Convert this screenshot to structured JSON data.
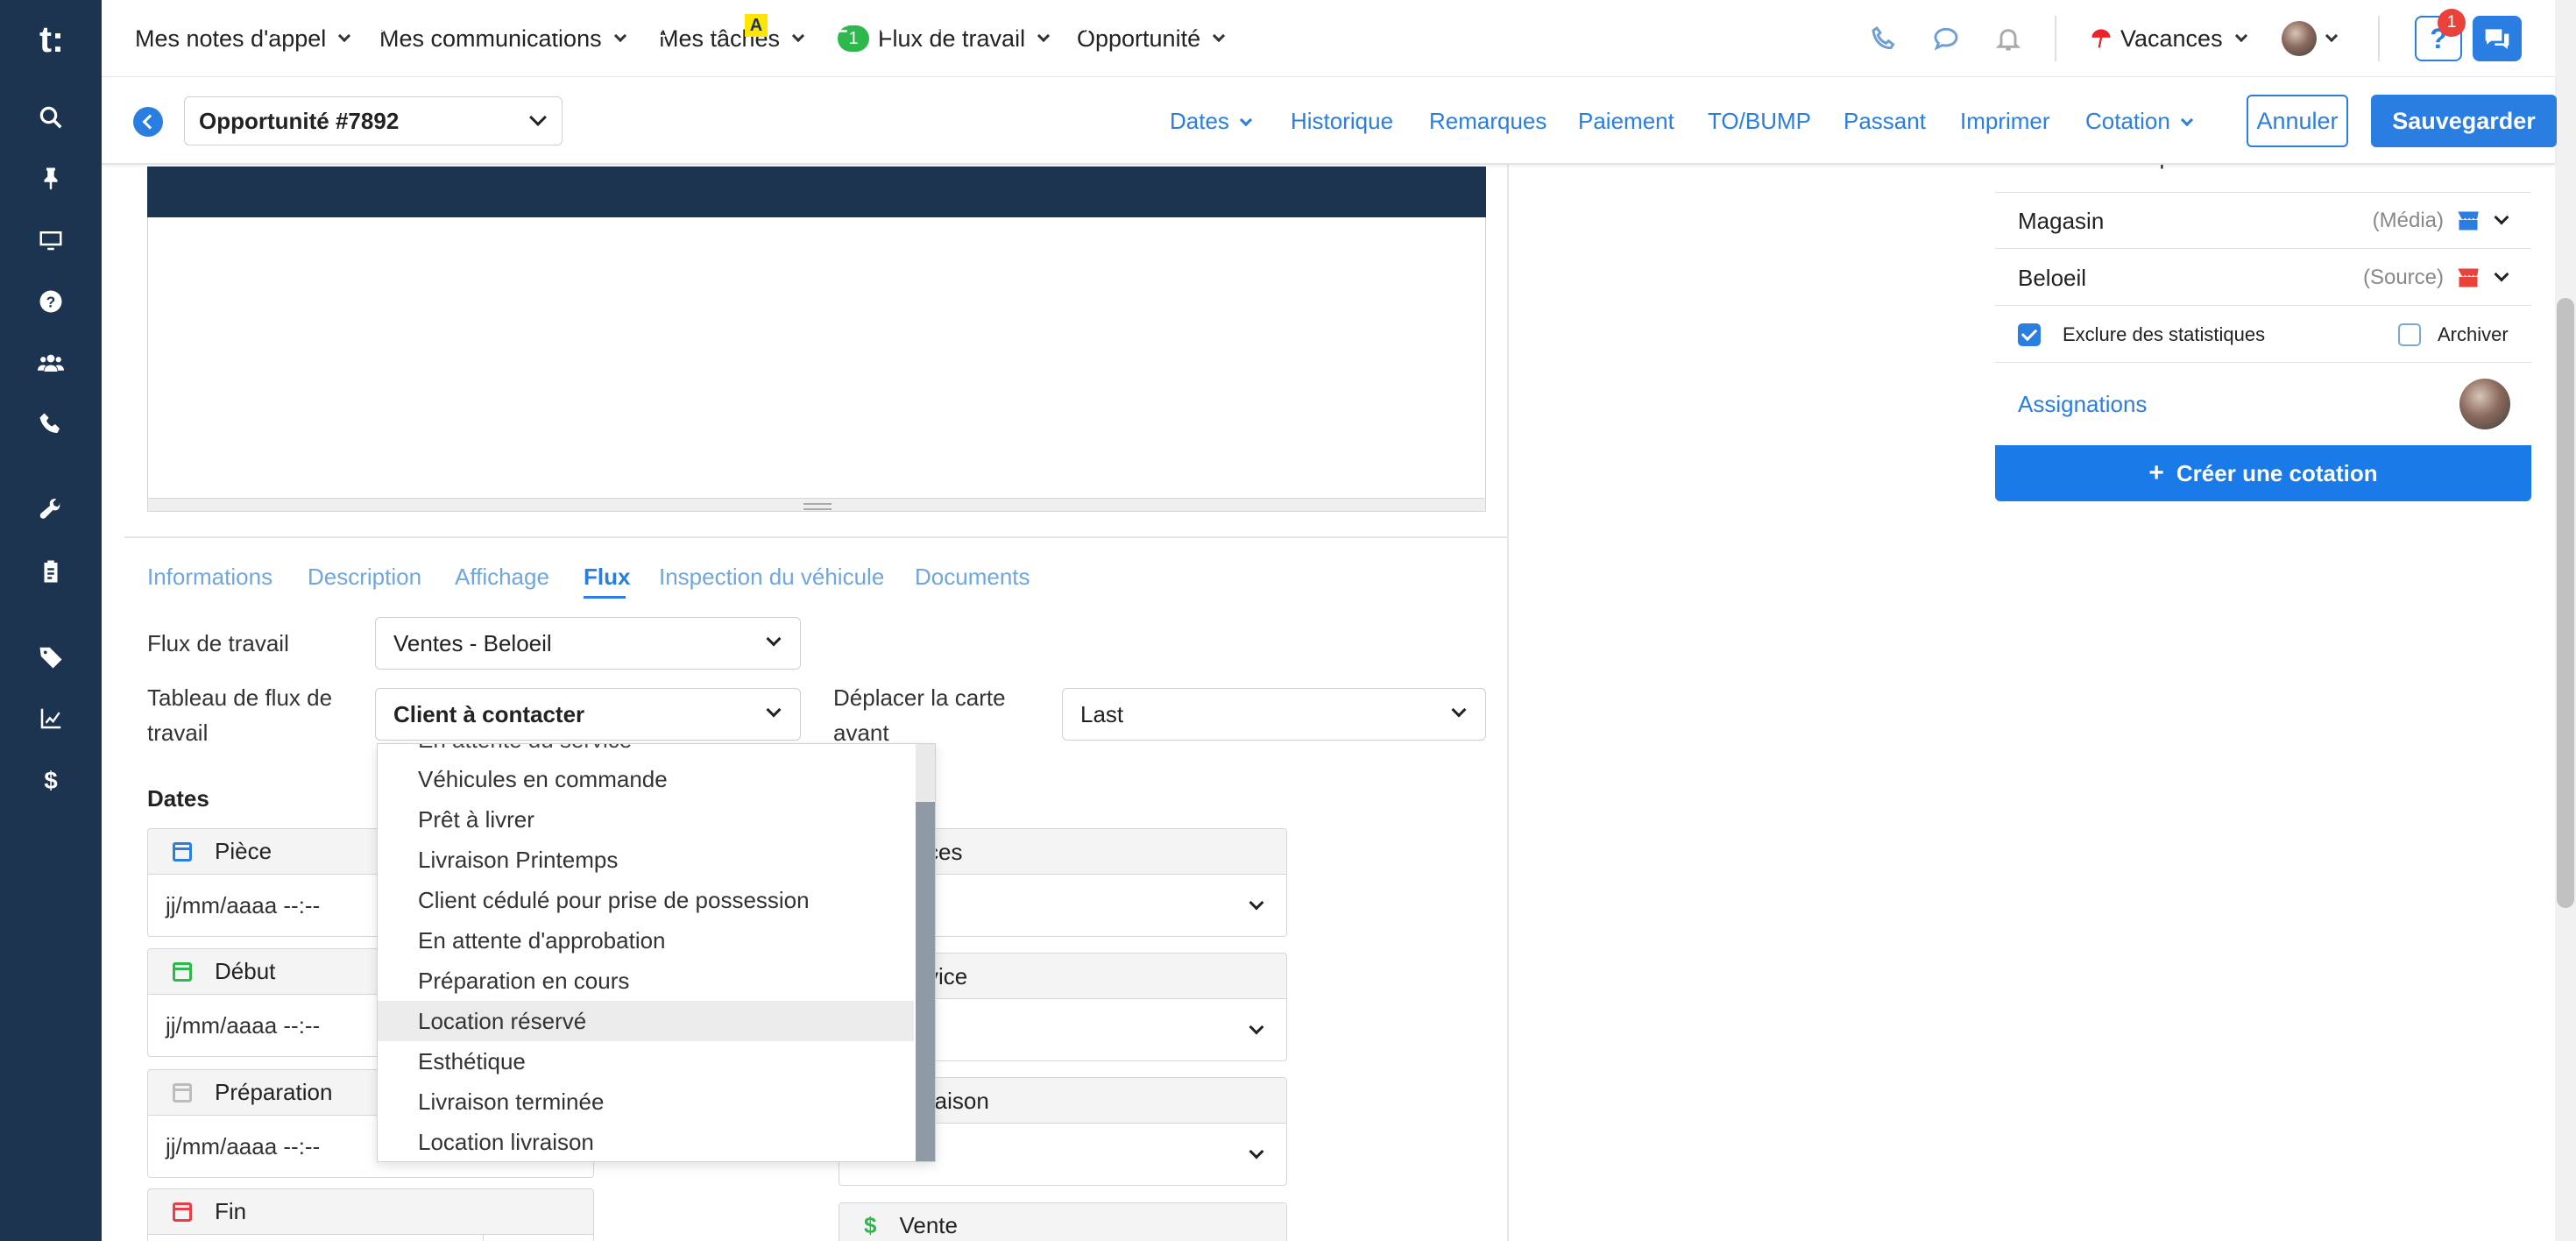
{
  "sidebar": {
    "logo": "t:",
    "items": [
      {
        "icon": "search-icon"
      },
      {
        "icon": "pin-icon"
      },
      {
        "icon": "monitor-icon"
      },
      {
        "icon": "help-icon"
      },
      {
        "icon": "users-icon"
      },
      {
        "icon": "phone-icon"
      },
      {
        "icon": "wrench-icon"
      },
      {
        "icon": "clipboard-icon"
      },
      {
        "icon": "tag-icon"
      },
      {
        "icon": "chart-icon"
      },
      {
        "icon": "dollar-icon"
      }
    ]
  },
  "topnav": {
    "call_notes": "Mes notes d'appel",
    "communications": "Mes communications",
    "tasks": "Mes tâches",
    "workflow_badge": "1",
    "workflow": "Flux de travail",
    "opportunity": "Opportunité",
    "vacances": "Vacances",
    "help_badge": "1",
    "help_label": "?"
  },
  "subbar": {
    "opportunity_select": "Opportunité #7892",
    "links": {
      "dates": "Dates",
      "historique": "Historique",
      "remarques": "Remarques",
      "paiement": "Paiement",
      "to_bump": "TO/BUMP",
      "passant": "Passant",
      "imprimer": "Imprimer",
      "cotation": "Cotation"
    },
    "cancel": "Annuler",
    "save": "Sauvegarder"
  },
  "editor": {
    "font": "sans-serif"
  },
  "tabs": {
    "informations": "Informations",
    "description": "Description",
    "affichage": "Affichage",
    "flux": "Flux",
    "inspection": "Inspection du véhicule",
    "documents": "Documents"
  },
  "form": {
    "workflow_label": "Flux de travail",
    "workflow_value": "Ventes - Beloeil",
    "board_label_line1": "Tableau de flux de",
    "board_label_line2": "travail",
    "board_value": "Client à contacter",
    "move_label_line1": "Déplacer la carte",
    "move_label_line2": "avant",
    "move_value": "Last",
    "dates_heading": "Dates"
  },
  "dates_left": [
    {
      "label": "Pièce",
      "value": "jj/mm/aaaa --:--",
      "color": "#2a7de1"
    },
    {
      "label": "Début",
      "value": "jj/mm/aaaa --:--",
      "color": "#2db84c"
    },
    {
      "label": "Préparation",
      "value": "jj/mm/aaaa --:--",
      "color": "#bdbdbd"
    },
    {
      "label": "Fin",
      "value": "",
      "color": "#e83e4a"
    }
  ],
  "dates_right": [
    {
      "label": "ces"
    },
    {
      "label": "vice"
    },
    {
      "label": "raison"
    },
    {
      "label": "Vente",
      "icon": "$"
    }
  ],
  "dropdown": {
    "partial_top": "En attente du service",
    "items": [
      "Véhicules en commande",
      "Prêt à livrer",
      "Livraison Printemps",
      "Client cédulé pour prise de possession",
      "En attente d'approbation",
      "Préparation en cours",
      "Location réservé",
      "Esthétique",
      "Livraison terminée",
      "Location livraison"
    ],
    "highlighted_index": 6
  },
  "right_panel": {
    "label_row": "Aucune étiquette",
    "magasin": {
      "name": "Magasin",
      "meta": "(Média)"
    },
    "beloeil": {
      "name": "Beloeil",
      "meta": "(Source)"
    },
    "exclude_stats": "Exclure des statistiques",
    "exclude_checked": true,
    "archive": "Archiver",
    "archive_checked": false,
    "assignations": "Assignations",
    "create_quote": "Créer une cotation"
  },
  "colors": {
    "sidebar": "#1c3450",
    "accent": "#2a7de1",
    "success": "#2db84c",
    "danger": "#e83e4a"
  }
}
